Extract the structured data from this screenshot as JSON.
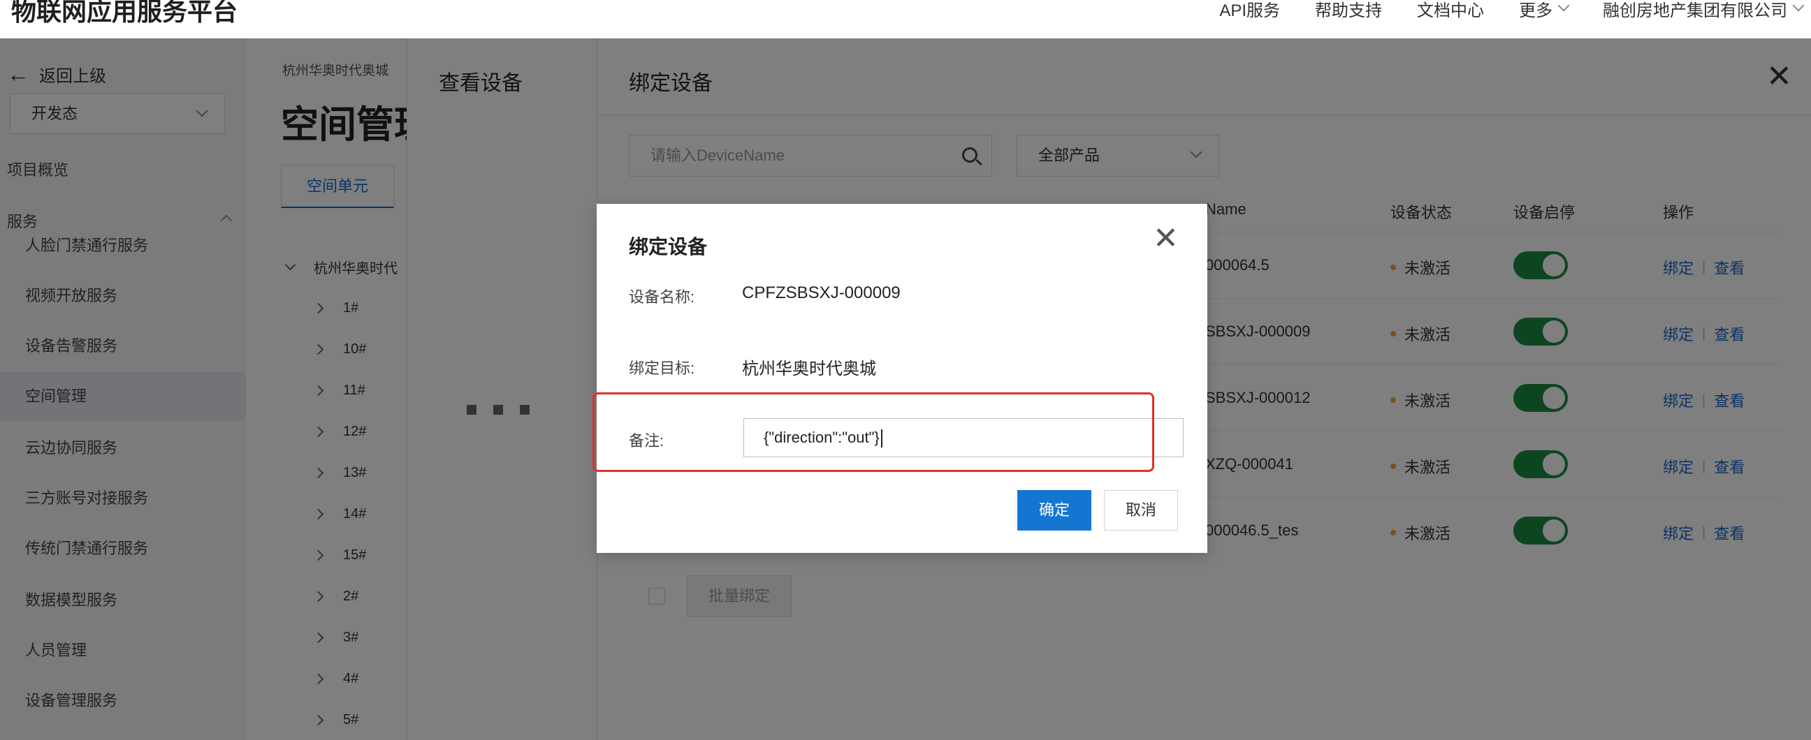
{
  "topbar": {
    "brand": "物联网应用服务平台",
    "nav": [
      "API服务",
      "帮助支持",
      "文档中心",
      "更多"
    ],
    "account": "融创房地产集团有限公司"
  },
  "sidebar": {
    "back_label": "返回上级",
    "env_value": "开发态",
    "overview": "项目概览",
    "services_group": "服务",
    "items": [
      "人脸门禁通行服务",
      "视频开放服务",
      "设备告警服务",
      "空间管理",
      "云边协同服务",
      "三方账号对接服务",
      "传统门禁通行服务",
      "数据模型服务",
      "人员管理",
      "设备管理服务"
    ],
    "active_index": 3
  },
  "space": {
    "breadcrumb": "杭州华奥时代奥城",
    "title": "空间管理",
    "subtab": "空间单元",
    "tree_root": "杭州华奥时代",
    "tree_children": [
      "1#",
      "10#",
      "11#",
      "12#",
      "13#",
      "14#",
      "15#",
      "2#",
      "3#",
      "4#",
      "5#"
    ]
  },
  "view_drawer": {
    "title": "查看设备"
  },
  "bind_drawer": {
    "title": "绑定设备",
    "search_placeholder": "请输入DeviceName",
    "product_select": "全部产品",
    "headers": {
      "device_name": "Name",
      "status": "设备状态",
      "toggle": "设备启停",
      "actions": "操作"
    },
    "rows": [
      {
        "device_name": "000064.5",
        "status": "未激活",
        "enabled": true
      },
      {
        "device_name": "SBSXJ-000009",
        "status": "未激活",
        "enabled": true
      },
      {
        "device_name": "SBSXJ-000012",
        "status": "未激活",
        "enabled": true
      },
      {
        "device_name": "XZQ-000041",
        "status": "未激活",
        "enabled": true
      },
      {
        "device_name": "000046.5_tes",
        "status": "未激活",
        "enabled": true
      }
    ],
    "action_bind": "绑定",
    "action_view": "查看",
    "batch_bind": "批量绑定"
  },
  "modal": {
    "title": "绑定设备",
    "device_name_label": "设备名称:",
    "device_name_value": "CPFZSBSXJ-000009",
    "target_label": "绑定目标:",
    "target_value": "杭州华奥时代奥城",
    "remark_label": "备注:",
    "remark_value": "{\"direction\":\"out\"}",
    "ok_label": "确定",
    "cancel_label": "取消"
  },
  "colors": {
    "primary": "#1576d2",
    "toggle_on": "#1d8a42",
    "status_inactive": "#f1a23b",
    "highlight": "#e0312c"
  }
}
